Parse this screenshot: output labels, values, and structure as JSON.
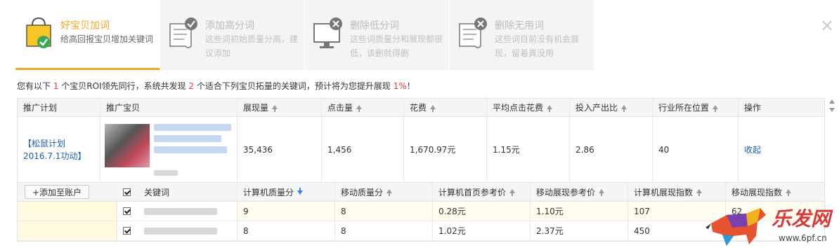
{
  "tabs": [
    {
      "title": "好宝贝加词",
      "desc": "给高回报宝贝增加关键词",
      "icon": "shopping-bag-check-icon"
    },
    {
      "title": "添加高分词",
      "desc": "这些词初始质量分高，建议添加",
      "icon": "document-check-icon"
    },
    {
      "title": "删除低分词",
      "desc": "这些词质量分和展现都很低，该删就得删",
      "icon": "monitor-remove-icon"
    },
    {
      "title": "删除无用词",
      "desc": "这些词目前没有机会展现，留着真没用",
      "icon": "document-remove-icon"
    }
  ],
  "close_label": "×",
  "notice": {
    "p1": "您有以下 ",
    "n1": "1",
    "p2": " 个宝贝ROI领先同行，系统共发现 ",
    "n2": "2",
    "p3": " 个适合下列宝贝拓量的关键词，预计将为您提升展现 ",
    "n3": "1%",
    "p4": "！"
  },
  "main_headers": [
    "推广计划",
    "推广宝贝",
    "展现量",
    "点击量",
    "花费",
    "平均点击花费",
    "投入产出比",
    "行业所在位置",
    "操作"
  ],
  "main_row": {
    "plan": "【松鼠计划2016.7.1功动】",
    "impressions": "35,436",
    "clicks": "1,456",
    "cost": "1,670.97元",
    "cpc": "1.15元",
    "roi": "2.86",
    "position": "40",
    "action": "收起"
  },
  "add_button": "+添加至账户",
  "sub_headers": [
    "关键词",
    "计算机质量分",
    "移动质量分",
    "计算机首页参考价",
    "移动展现参考价",
    "计算机展现指数",
    "移动展现指数"
  ],
  "sub_rows": [
    {
      "pc_score": "9",
      "mobile_score": "8",
      "pc_price": "0.28元",
      "mobile_price": "1.10元",
      "pc_index": "107",
      "mobile_index": "62"
    },
    {
      "pc_score": "8",
      "mobile_score": "8",
      "pc_price": "1.02元",
      "mobile_price": "2.37元",
      "pc_index": "450",
      "mobile_index": ""
    }
  ],
  "watermark": {
    "brand": "乐发网",
    "url": "www.6pf.cn"
  },
  "colors": {
    "accent": "#f5a623",
    "link": "#1f5fb0",
    "highlight": "#e4393c"
  }
}
